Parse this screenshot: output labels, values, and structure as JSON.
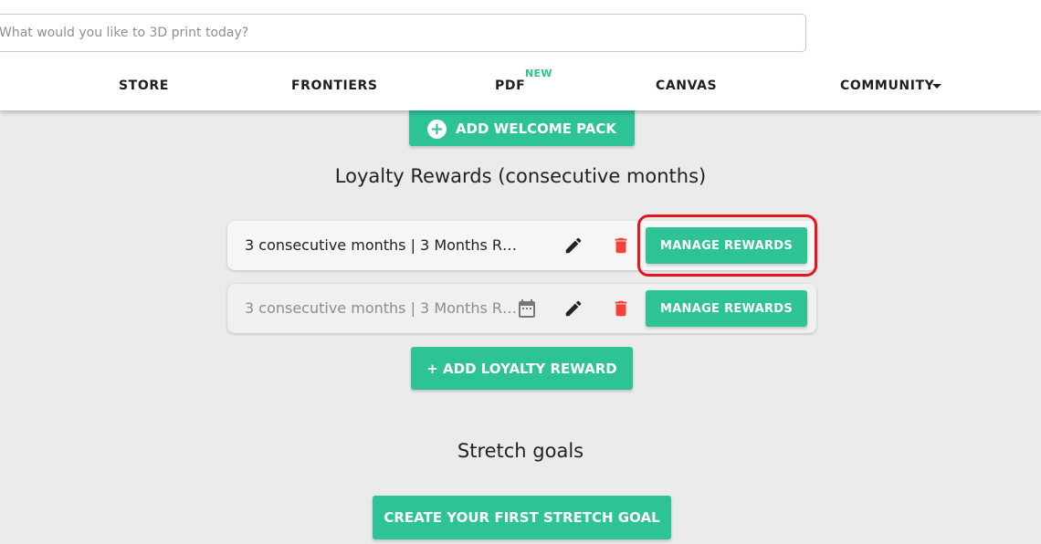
{
  "header": {
    "search_placeholder": "What would you like to 3D print today?",
    "nav": {
      "store": "STORE",
      "frontiers": "FRONTIERS",
      "pdf": "PDF",
      "pdf_badge": "NEW",
      "canvas": "CANVAS",
      "community": "COMMUNITY"
    }
  },
  "welcome": {
    "button_label": "ADD WELCOME PACK"
  },
  "loyalty": {
    "title": "Loyalty Rewards (consecutive months)",
    "rows": [
      {
        "text": "3 consecutive months | 3 Months R…",
        "manage_label": "MANAGE REWARDS"
      },
      {
        "text": "3 consecutive months | 3 Months R…",
        "manage_label": "MANAGE REWARDS"
      }
    ],
    "add_label": "+ ADD LOYALTY REWARD"
  },
  "stretch": {
    "title": "Stretch goals",
    "create_label": "CREATE YOUR FIRST STRETCH GOAL"
  },
  "colors": {
    "accent": "#2ec297",
    "delete": "#f04438",
    "highlight": "#e8141c"
  }
}
